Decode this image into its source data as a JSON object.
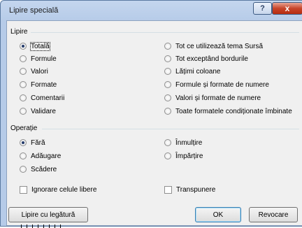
{
  "window": {
    "title": "Lipire specială",
    "help_label": "?",
    "close_label": "x"
  },
  "paste_group": {
    "label": "Lipire",
    "options_left": [
      {
        "label": "Totală",
        "checked": true
      },
      {
        "label": "Formule",
        "checked": false
      },
      {
        "label": "Valori",
        "checked": false
      },
      {
        "label": "Formate",
        "checked": false
      },
      {
        "label": "Comentarii",
        "checked": false
      },
      {
        "label": "Validare",
        "checked": false
      }
    ],
    "options_right": [
      {
        "label": "Tot ce utilizează tema Sursă",
        "checked": false
      },
      {
        "label": "Tot exceptând bordurile",
        "checked": false
      },
      {
        "label": "Lățimi coloane",
        "checked": false
      },
      {
        "label": "Formule și formate de numere",
        "checked": false
      },
      {
        "label": "Valori și formate de numere",
        "checked": false
      },
      {
        "label": "Toate formatele condiționate îmbinate",
        "checked": false
      }
    ]
  },
  "operation_group": {
    "label": "Operație",
    "options_left": [
      {
        "label": "Fără",
        "checked": true
      },
      {
        "label": "Adăugare",
        "checked": false
      },
      {
        "label": "Scădere",
        "checked": false
      }
    ],
    "options_right": [
      {
        "label": "Înmulțire",
        "checked": false
      },
      {
        "label": "Împărțire",
        "checked": false
      }
    ]
  },
  "checkboxes": {
    "skip_blanks": {
      "label": "Ignorare celule libere",
      "checked": false
    },
    "transpose": {
      "label": "Transpunere",
      "checked": false
    }
  },
  "buttons": {
    "paste_link": "Lipire cu legătură",
    "ok": "OK",
    "cancel": "Revocare"
  }
}
